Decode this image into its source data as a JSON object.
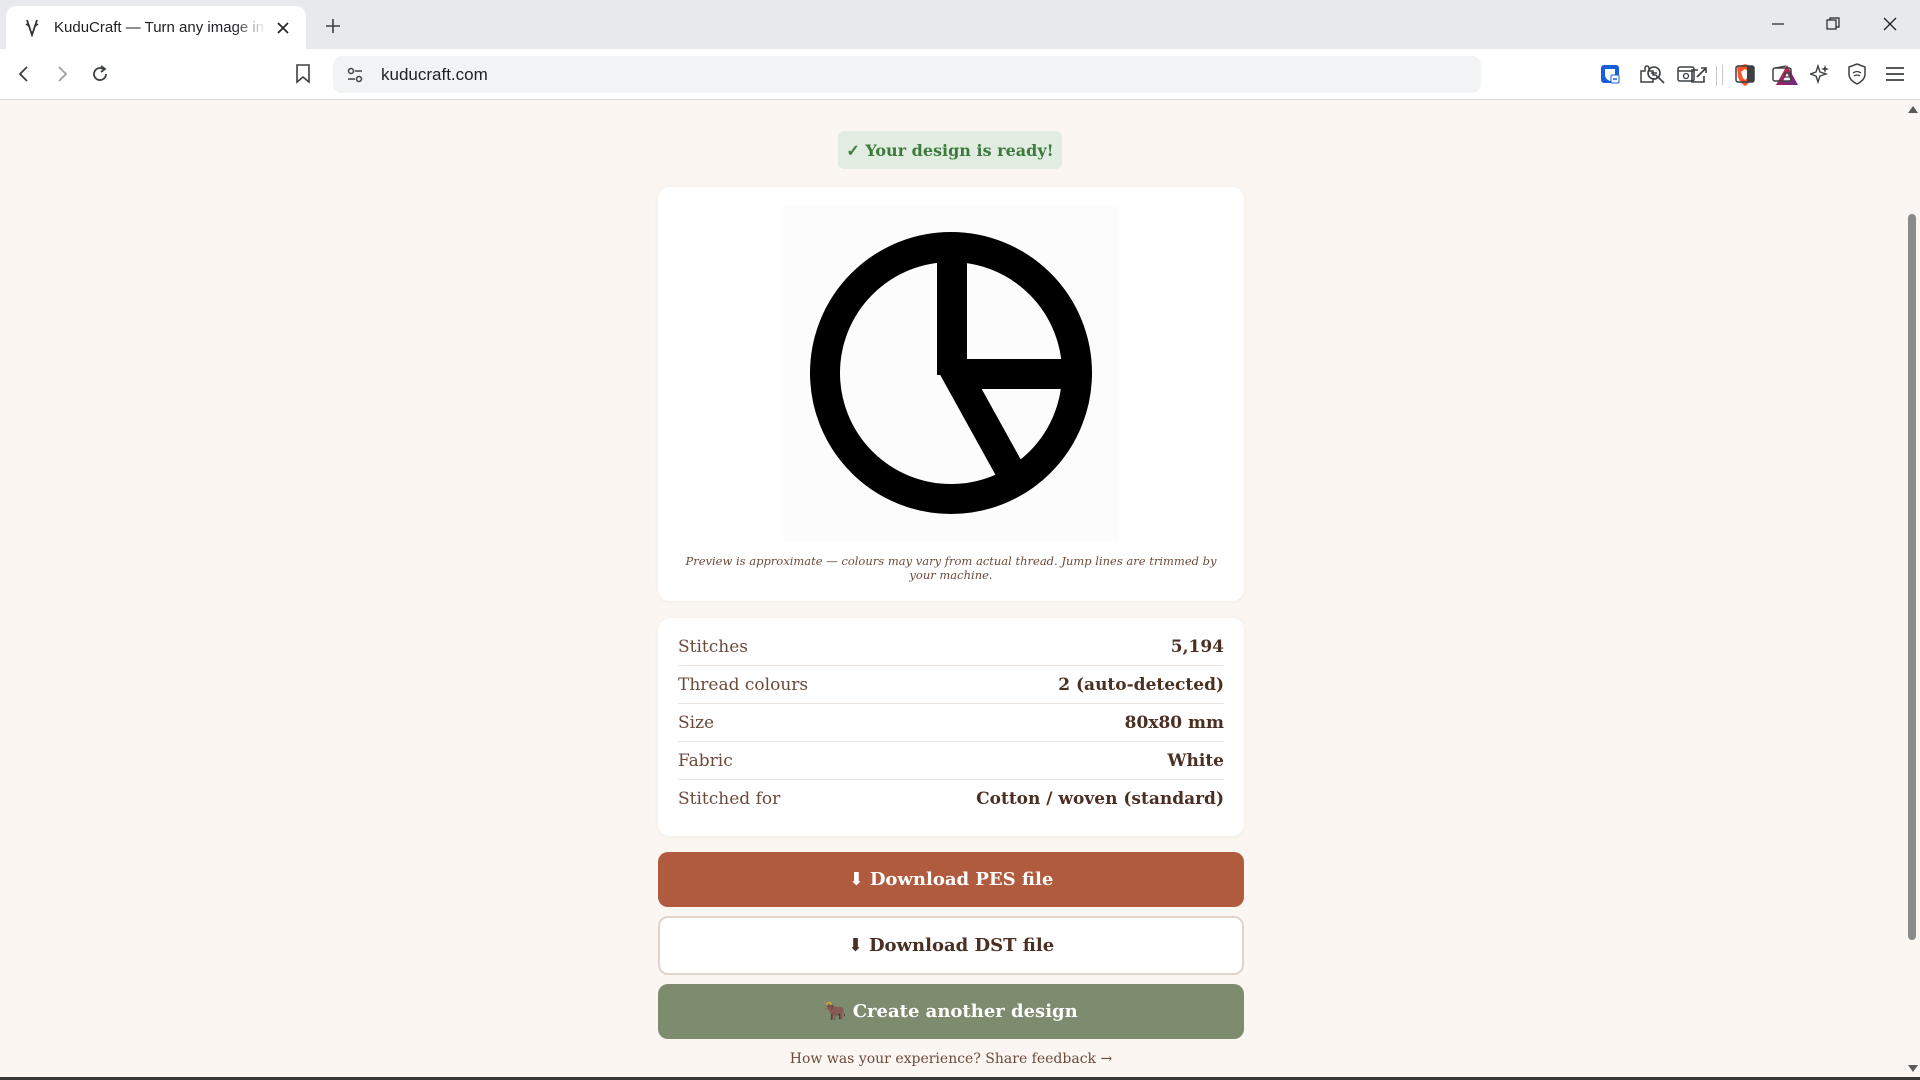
{
  "browser": {
    "tab_title": "KuduCraft — Turn any image into embroidery",
    "url": "kuducraft.com"
  },
  "page": {
    "ready_badge": "✓ Your design is ready!",
    "preview_note": "Preview is approximate — colours may vary from actual thread. Jump lines are trimmed by your machine.",
    "stats": [
      {
        "label": "Stitches",
        "value": "5,194"
      },
      {
        "label": "Thread colours",
        "value": "2 (auto-detected)"
      },
      {
        "label": "Size",
        "value": "80x80 mm"
      },
      {
        "label": "Fabric",
        "value": "White"
      },
      {
        "label": "Stitched for",
        "value": "Cotton / woven (standard)"
      }
    ],
    "buttons": {
      "download_pes_icon": "⬇",
      "download_pes": "Download PES file",
      "download_dst_icon": "⬇",
      "download_dst": "Download DST file",
      "create_icon": "🐂",
      "create_another": "Create another design"
    },
    "feedback_link": "How was your experience? Share feedback →"
  },
  "colors": {
    "page_bg": "#fbf6f1",
    "accent_pes": "#b05a3e",
    "accent_create": "#7d8c6e",
    "ready_bg": "#e0ede0",
    "ready_text": "#3e7a3e",
    "text_brown": "#4a2f22"
  },
  "icons": [
    "kudu-favicon",
    "close-icon",
    "plus-icon",
    "minimize-icon",
    "restore-icon",
    "back-icon",
    "forward-icon",
    "reload-icon",
    "bookmark-icon",
    "site-settings-icon",
    "zoom-icon",
    "share-icon",
    "brave-shield-icon",
    "rewards-icon",
    "bitwarden-icon",
    "extensions-icon",
    "reader-icon",
    "sidebar-icon",
    "wallet-icon",
    "leo-icon",
    "vpn-icon",
    "menu-icon"
  ]
}
